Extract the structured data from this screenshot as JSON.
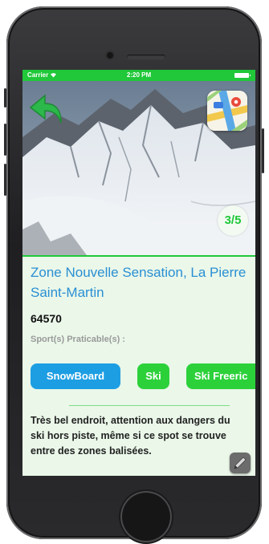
{
  "status_bar": {
    "carrier": "Carrier",
    "wifi_icon": "wifi-icon",
    "time": "2:20 PM",
    "battery_icon": "battery-icon"
  },
  "colors": {
    "accent_green": "#20c83a",
    "title_blue": "#2a8fd3",
    "chip_blue": "#1d9ee3",
    "chip_green": "#2cd13a",
    "background": "#eaf7e9"
  },
  "photo": {
    "counter": "3/5",
    "back_icon": "back-arrow-icon",
    "maps_icon": "maps-app-icon"
  },
  "spot": {
    "title": "Zone Nouvelle Sensation, La Pierre Saint-Martin",
    "postcode": "64570",
    "sports_label": "Sport(s) Praticable(s) :",
    "sports": [
      "SnowBoard",
      "Ski",
      "Ski Freeric"
    ],
    "description": "Très bel endroit, attention aux dangers du ski hors piste, même si ce spot se trouve entre des zones balisées.",
    "edit_icon": "pencil-icon"
  }
}
